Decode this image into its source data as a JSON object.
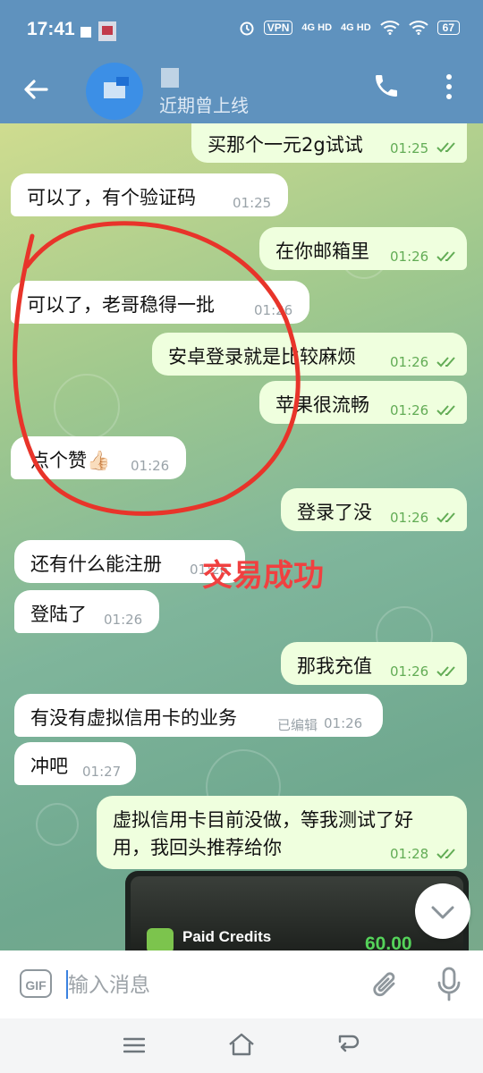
{
  "status_bar": {
    "time": "17:41",
    "vpn": "VPN",
    "network_1": "4G HD",
    "network_2": "4G HD",
    "battery": "67"
  },
  "header": {
    "last_seen": "近期曾上线",
    "icons": [
      "back-arrow-icon",
      "phone-icon",
      "more-vert-icon"
    ]
  },
  "messages": [
    {
      "dir": "out",
      "text": "买那个一元2g试试",
      "time": "01:25",
      "read": true
    },
    {
      "dir": "in",
      "text": "可以了，有个验证码",
      "time": "01:25"
    },
    {
      "dir": "out",
      "text": "在你邮箱里",
      "time": "01:26",
      "read": true
    },
    {
      "dir": "in",
      "text": "可以了，老哥稳得一批",
      "time": "01:26"
    },
    {
      "dir": "out",
      "text": "安卓登录就是比较麻烦",
      "time": "01:26",
      "read": true
    },
    {
      "dir": "out",
      "text": "苹果很流畅",
      "time": "01:26",
      "read": true
    },
    {
      "dir": "in",
      "text": "点个赞👍🏻",
      "time": "01:26"
    },
    {
      "dir": "out",
      "text": "登录了没",
      "time": "01:26",
      "read": true
    },
    {
      "dir": "in",
      "text": "还有什么能注册",
      "time": "01:26"
    },
    {
      "dir": "in",
      "text": "登陆了",
      "time": "01:26"
    },
    {
      "dir": "out",
      "text": "那我充值",
      "time": "01:26",
      "read": true
    },
    {
      "dir": "in",
      "text": "有没有虚拟信用卡的业务",
      "edited": "已编辑",
      "time": "01:26"
    },
    {
      "dir": "in",
      "text": "冲吧",
      "time": "01:27"
    },
    {
      "dir": "out",
      "text_line1": "虚拟信用卡目前没做，等我测试了好",
      "text_line2": "用，我回头推荐给你",
      "time": "01:28",
      "read": true
    }
  ],
  "annotation": "交易成功",
  "media_preview": {
    "label": "Paid Credits",
    "value": "60.00"
  },
  "input_bar": {
    "gif_label": "GIF",
    "placeholder": "输入消息"
  },
  "colors": {
    "header": "#5f92be",
    "outgoing_bubble": "#efffde",
    "incoming_bubble": "#ffffff",
    "annotation": "#f04040",
    "read_ticks": "#62ac55"
  }
}
